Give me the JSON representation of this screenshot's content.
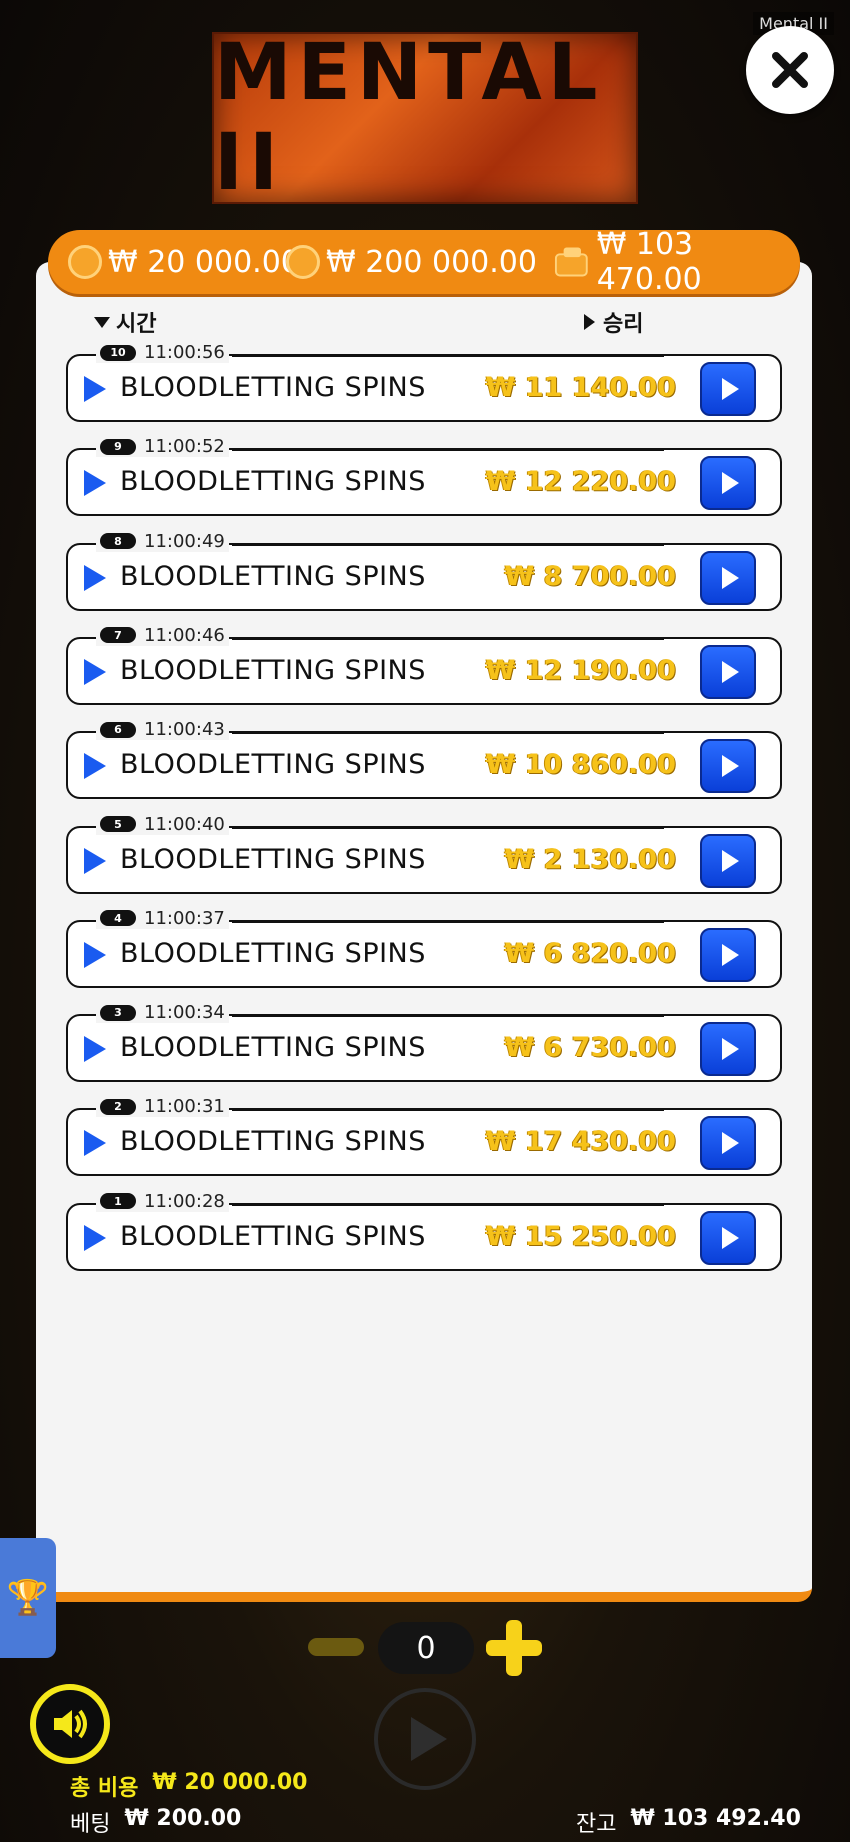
{
  "window": {
    "title": "Mental II"
  },
  "logo": {
    "text": "MENTAL II"
  },
  "topbar": {
    "total_bet": "₩ 20 000.00",
    "max_win": "₩ 200 000.00",
    "balance": "₩ 103 470.00"
  },
  "headers": {
    "time": "시간",
    "win": "승리"
  },
  "rows": [
    {
      "index": "10",
      "time": "11:00:56",
      "label": "BLOODLETTING SPINS",
      "amount": "₩ 11 140.00"
    },
    {
      "index": "9",
      "time": "11:00:52",
      "label": "BLOODLETTING SPINS",
      "amount": "₩ 12 220.00"
    },
    {
      "index": "8",
      "time": "11:00:49",
      "label": "BLOODLETTING SPINS",
      "amount": "₩ 8 700.00"
    },
    {
      "index": "7",
      "time": "11:00:46",
      "label": "BLOODLETTING SPINS",
      "amount": "₩ 12 190.00"
    },
    {
      "index": "6",
      "time": "11:00:43",
      "label": "BLOODLETTING SPINS",
      "amount": "₩ 10 860.00"
    },
    {
      "index": "5",
      "time": "11:00:40",
      "label": "BLOODLETTING SPINS",
      "amount": "₩ 2 130.00"
    },
    {
      "index": "4",
      "time": "11:00:37",
      "label": "BLOODLETTING SPINS",
      "amount": "₩ 6 820.00"
    },
    {
      "index": "3",
      "time": "11:00:34",
      "label": "BLOODLETTING SPINS",
      "amount": "₩ 6 730.00"
    },
    {
      "index": "2",
      "time": "11:00:31",
      "label": "BLOODLETTING SPINS",
      "amount": "₩ 17 430.00"
    },
    {
      "index": "1",
      "time": "11:00:28",
      "label": "BLOODLETTING SPINS",
      "amount": "₩ 15 250.00"
    }
  ],
  "stepper": {
    "value": "0"
  },
  "footer": {
    "total_cost_label": "총 비용",
    "total_cost_value": "₩ 20 000.00",
    "bet_label": "베팅",
    "bet_value": "₩ 200.00",
    "balance_label": "잔고",
    "balance_value": "₩ 103 492.40"
  },
  "colors": {
    "accent": "#f08a12",
    "replay": "#1a5bf0",
    "win": "#f6c21a"
  },
  "icons": {
    "close": "close-icon",
    "coin": "coin-icon",
    "wallet": "wallet-icon",
    "trophy": "trophy-icon",
    "sound": "sound-icon"
  }
}
